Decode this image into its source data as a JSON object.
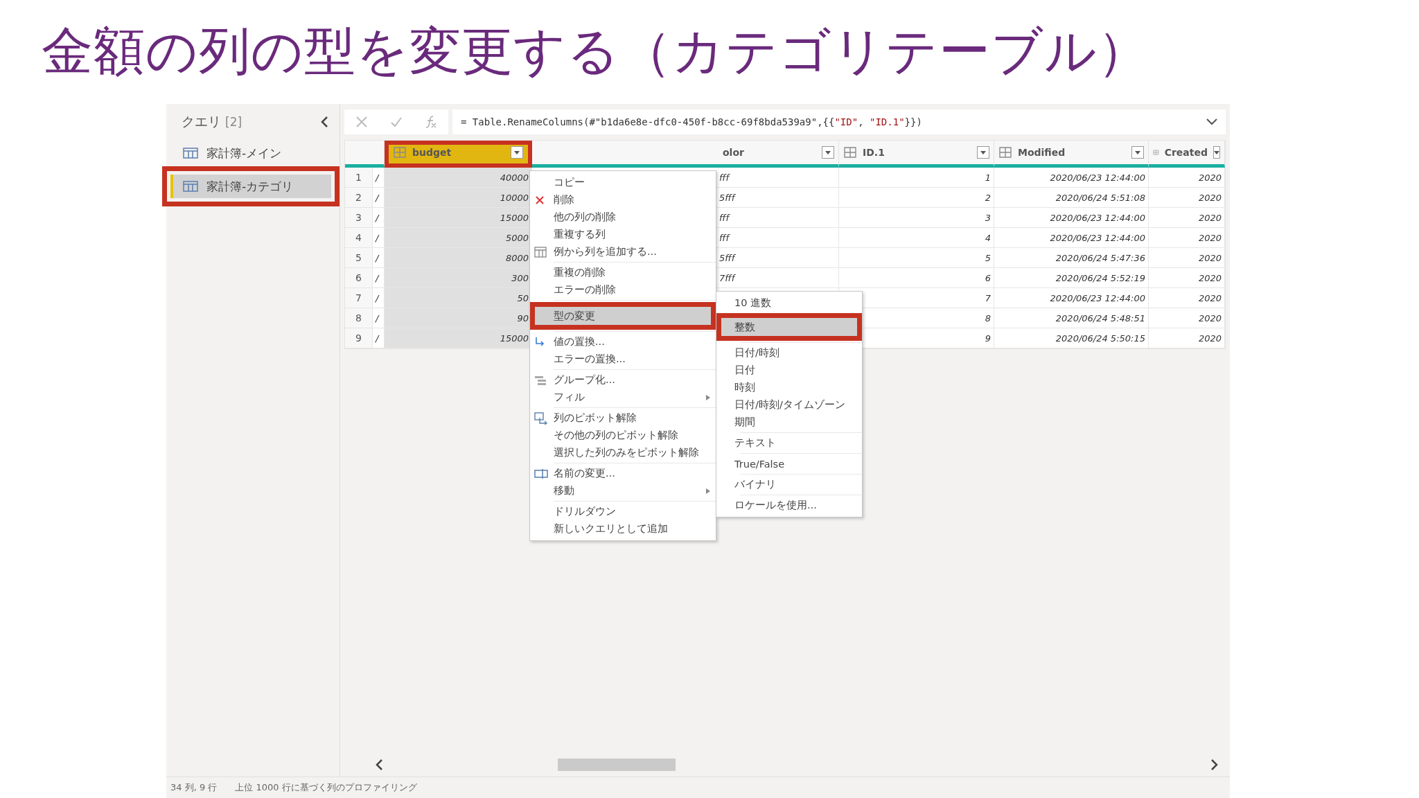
{
  "slide_title": "金額の列の型を変更する（カテゴリテーブル）",
  "queries": {
    "title": "クエリ",
    "count": "[2]",
    "items": [
      {
        "label": "家計簿-メイン",
        "selected": false
      },
      {
        "label": "家計簿-カテゴリ",
        "selected": true
      }
    ]
  },
  "formula": [
    {
      "kind": "code",
      "text": "= Table.RenameColumns(#\"b1da6e8e-dfc0-450f-b8cc-69f8bda539a9\",{{"
    },
    {
      "kind": "string",
      "text": "\"ID\""
    },
    {
      "kind": "code",
      "text": ", "
    },
    {
      "kind": "string",
      "text": "\"ID.1\""
    },
    {
      "kind": "code",
      "text": "}})"
    }
  ],
  "table": {
    "columns": [
      {
        "name": "budget",
        "selected": true
      },
      {
        "name": "olor",
        "selected": false
      },
      {
        "name": "ID.1",
        "selected": false
      },
      {
        "name": "Modified",
        "selected": false
      },
      {
        "name": "Created",
        "selected": false
      }
    ],
    "rows": [
      {
        "number": "1",
        "mark": "/",
        "budget": "40000",
        "column_2": "fff",
        "id": "1",
        "modified": "2020/06/23 12:44:00",
        "created": "2020"
      },
      {
        "number": "2",
        "mark": "/",
        "budget": "10000",
        "column_2": "5fff",
        "id": "2",
        "modified": "2020/06/24 5:51:08",
        "created": "2020"
      },
      {
        "number": "3",
        "mark": "/",
        "budget": "15000",
        "column_2": "fff",
        "id": "3",
        "modified": "2020/06/23 12:44:00",
        "created": "2020"
      },
      {
        "number": "4",
        "mark": "/",
        "budget": "5000",
        "column_2": "fff",
        "id": "4",
        "modified": "2020/06/23 12:44:00",
        "created": "2020"
      },
      {
        "number": "5",
        "mark": "/",
        "budget": "8000",
        "column_2": "5fff",
        "id": "5",
        "modified": "2020/06/24 5:47:36",
        "created": "2020"
      },
      {
        "number": "6",
        "mark": "/",
        "budget": "300",
        "column_2": "7fff",
        "id": "6",
        "modified": "2020/06/24 5:52:19",
        "created": "2020"
      },
      {
        "number": "7",
        "mark": "/",
        "budget": "50",
        "id": "7",
        "modified": "2020/06/23 12:44:00",
        "created": "2020"
      },
      {
        "number": "8",
        "mark": "/",
        "budget": "90",
        "id": "8",
        "modified": "2020/06/24 5:48:51",
        "created": "2020"
      },
      {
        "number": "9",
        "mark": "/",
        "budget": "15000",
        "id": "9",
        "modified": "2020/06/24 5:50:15",
        "created": "2020"
      }
    ]
  },
  "context_menu": {
    "groups": [
      [
        {
          "label": "コピー",
          "selected": false,
          "submenu": false
        },
        {
          "label": "削除",
          "selected": false,
          "submenu": false,
          "kind": "delete"
        },
        {
          "label": "他の列の削除",
          "selected": false,
          "submenu": false
        },
        {
          "label": "重複する列",
          "selected": false,
          "submenu": false
        },
        {
          "label": "例から列を追加する...",
          "selected": false,
          "submenu": false,
          "kind": "table"
        }
      ],
      [
        {
          "label": "重複の削除",
          "selected": false,
          "submenu": false
        },
        {
          "label": "エラーの削除",
          "selected": false,
          "submenu": false
        }
      ],
      [
        {
          "label": "型の変更",
          "selected": true,
          "submenu": false
        }
      ],
      [
        {
          "label": "値の置換...",
          "selected": false,
          "submenu": false,
          "kind": "replace"
        },
        {
          "label": "エラーの置換...",
          "selected": false,
          "submenu": false
        }
      ],
      [
        {
          "label": "グループ化...",
          "selected": false,
          "submenu": false,
          "kind": "group"
        },
        {
          "label": "フィル",
          "selected": false,
          "submenu": true
        }
      ],
      [
        {
          "label": "列のピボット解除",
          "selected": false,
          "submenu": false,
          "kind": "unpivot"
        },
        {
          "label": "その他の列のピボット解除",
          "selected": false,
          "submenu": false
        },
        {
          "label": "選択した列のみをピボット解除",
          "selected": false,
          "submenu": false
        }
      ],
      [
        {
          "label": "名前の変更...",
          "selected": false,
          "submenu": false,
          "kind": "rename"
        },
        {
          "label": "移動",
          "selected": false,
          "submenu": true
        }
      ],
      [
        {
          "label": "ドリルダウン",
          "selected": false,
          "submenu": false
        },
        {
          "label": "新しいクエリとして追加",
          "selected": false,
          "submenu": false
        }
      ]
    ]
  },
  "type_submenu": {
    "groups": [
      [
        {
          "label": "10 進数",
          "selected": false
        },
        {
          "label": "整数",
          "selected": true
        }
      ],
      [
        {
          "label": "日付/時刻",
          "selected": false
        },
        {
          "label": "日付",
          "selected": false
        },
        {
          "label": "時刻",
          "selected": false
        },
        {
          "label": "日付/時刻/タイムゾーン",
          "selected": false
        },
        {
          "label": "期間",
          "selected": false
        }
      ],
      [
        {
          "label": "テキスト",
          "selected": false
        }
      ],
      [
        {
          "label": "True/False",
          "selected": false
        }
      ],
      [
        {
          "label": "バイナリ",
          "selected": false
        }
      ],
      [
        {
          "label": "ロケールを使用...",
          "selected": false
        }
      ]
    ]
  },
  "status_bar": {
    "size": "34 列, 9 行",
    "profiling": "上位 1000 行に基づく列のプロファイリング"
  }
}
